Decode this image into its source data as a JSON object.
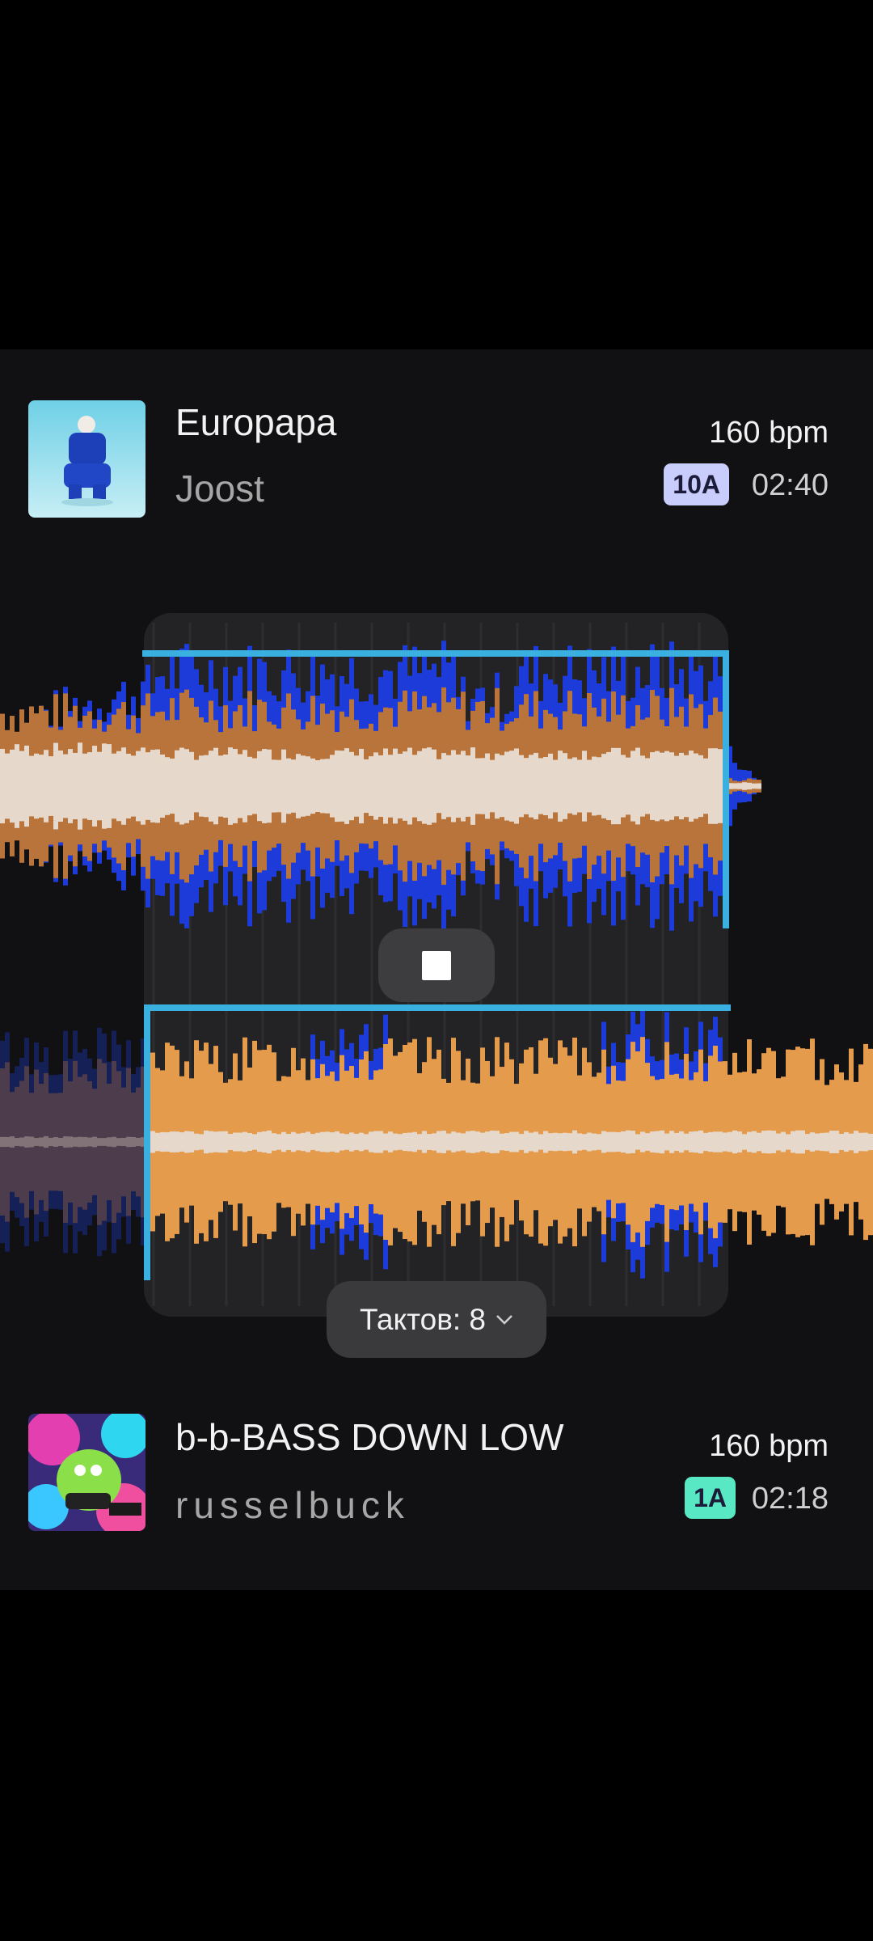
{
  "deck_top": {
    "title": "Europapa",
    "artist": "Joost",
    "bpm": "160 bpm",
    "key": "10A",
    "key_color": "#c9cdfb",
    "duration": "02:40"
  },
  "deck_bottom": {
    "title": "b-b-BASS DOWN LOW",
    "artist": "russelbuck",
    "bpm": "160 bpm",
    "key": "1A",
    "key_color": "#58e8c4",
    "duration": "02:18"
  },
  "transport": {
    "stop_icon": "stop-icon"
  },
  "bars_selector": {
    "label": "Тактов: 8",
    "icon": "chevron-down-icon"
  },
  "colors": {
    "panel_bg": "#111113",
    "cue_line": "#3ab0e0",
    "wave_blue": "#1c3bd8",
    "wave_orange": "#b8743a",
    "wave_light_orange": "#e59b4c",
    "wave_cream": "#e6d9cc"
  }
}
